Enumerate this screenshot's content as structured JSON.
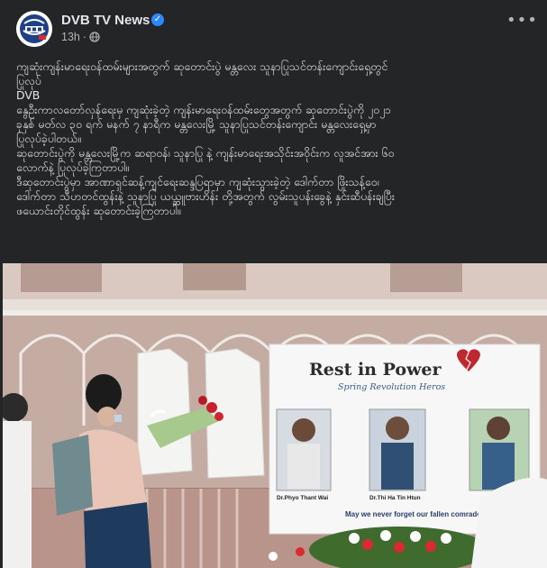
{
  "page": {
    "name": "DVB TV News",
    "time": "13h",
    "privacy_icon": "globe-icon",
    "verified_icon": "verified-badge-icon",
    "more_icon": "more-options-icon",
    "avatar_icon": "dvb-logo-icon"
  },
  "post": {
    "lines": [
      "ကျဆုံးကျန်းမာရေးဝန်ထမ်းများအတွက် ဆုတောင်းပွဲ မန္တလေး သူနာပြုသင်တန်းကျောင်းရှေ့တွင်",
      "ပြုလုပ်",
      "DVB",
      "နွေဦးကာလတော်လှန်ရေးမှ ကျဆုံးခဲ့တဲ့ ကျန်းမာရေးဝန်ထမ်းတွေအတွက် ဆုတောင်းပွဲကို ၂၀၂၁",
      "ခုနှစ် မတ်လ ၃၀ ရက် မနက် ၇ နာရီက မန္တလေးမြို့ သူနာပြုသင်တန်းကျောင်း မန္တလေးရှေ့မှာ",
      "ပြုလုပ်ခဲ့ပါတယ်။",
      "ဆုတောင်းပွဲကို မန္တလေးမြို့က ဆရာဝန်၊ သူနာပြု နဲ့ ကျန်းမာရေးအသိုင်းအဝိုင်းက လူအင်အား ၆၀",
      "လောက်နဲ့ ပြုလုပ်ခဲ့ကြတာပါ။",
      "ဒီဆုတောင်းပွဲမှာ အာဏာရှင်ဆန့်ကျင်ရေးဆန္ဒပြရာမှာ ကျဆုံးသွားခဲ့တဲ့ ဒေါက်တာ ဖြိုးသန့်ဝေ၊",
      "ဒေါက်တာ သီဟတင်ထွန်းနဲ့ သူနာပြု ယယ္ဆူဗားဟိန်း တို့အတွက် လွမ်းသူပန်းခွေနဲ့ နှင်းဆီပန်းချပြီး",
      "ဖယောင်းတိုင်ထွန်း ဆုတောင်းခဲ့ကြတာပါ။"
    ]
  },
  "photo": {
    "banner_title": "Rest in Power",
    "banner_subtitle": "Spring Revolution Heros",
    "heart_icon": "broken-heart-icon",
    "portraits": [
      {
        "caption": "Dr.Phyo Thant Wai"
      },
      {
        "caption": "Dr.Thi Ha Tin Htun"
      },
      {
        "caption": ""
      }
    ],
    "bottom_text": "May we never forget our fallen comrade"
  }
}
